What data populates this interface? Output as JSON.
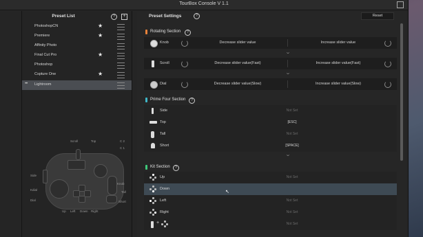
{
  "window": {
    "title": "TourBox Console V 1.1"
  },
  "preset_list": {
    "title": "Preset List",
    "help_icon": "?",
    "add_icon": "+",
    "items": [
      {
        "label": "PhotoshopCN",
        "starred": true
      },
      {
        "label": "Premiere",
        "starred": true
      },
      {
        "label": "Affinity Photo",
        "starred": false
      },
      {
        "label": "Final Cut Pro",
        "starred": true
      },
      {
        "label": "Photoshop",
        "starred": false
      },
      {
        "label": "Cspture One",
        "starred": true
      },
      {
        "label": "Lightroom",
        "starred": false,
        "active": true,
        "dots": "•••"
      }
    ],
    "device_labels": {
      "scroll": "Scroll",
      "top": "Top",
      "c2": "C 2",
      "c1": "C 1",
      "side": "Side",
      "knob": "Knob",
      "tall": "Tall",
      "short": "Short",
      "kdial": "Kdial",
      "dial": "Dial",
      "up": "Up",
      "left": "Left",
      "down": "Down",
      "right": "Right"
    }
  },
  "settings": {
    "title": "Preset Settings",
    "help_icon": "?",
    "reset_label": "Reset",
    "rotating": {
      "title": "Rotating Section",
      "help_icon": "?",
      "color": "#e8823a",
      "rows": [
        {
          "label": "Knob",
          "left": "Decrease slider value",
          "right": "Increase slider value"
        },
        {
          "label": "Scroll",
          "left": "Decrease slider value(Fast)",
          "right": "Increase slider value(Fast)"
        },
        {
          "label": "Dial",
          "left": "Decrease slider value(Slow)",
          "right": "Increase slider value(Slow)"
        }
      ]
    },
    "prime": {
      "title": "Prime Four Section",
      "help_icon": "?",
      "color": "#3fb7c8",
      "rows": [
        {
          "label": "Side",
          "value": "Not Set",
          "set": false
        },
        {
          "label": "Top",
          "value": "[ESC]",
          "set": true
        },
        {
          "label": "Tall",
          "value": "Not Set",
          "set": false
        },
        {
          "label": "Short",
          "value": "[SPACE]",
          "set": true
        }
      ]
    },
    "kit": {
      "title": "Kit Section",
      "help_icon": "?",
      "color": "#3fc87a",
      "rows": [
        {
          "label": "Up",
          "value": "Not Set",
          "set": false
        },
        {
          "label": "Down",
          "value": "",
          "set": false,
          "selected": true
        },
        {
          "label": "Left",
          "value": "Not Set",
          "set": false
        },
        {
          "label": "Right",
          "value": "Not Set",
          "set": false
        },
        {
          "label": "",
          "value": "Not Set",
          "set": false,
          "combo": "+"
        }
      ]
    }
  }
}
